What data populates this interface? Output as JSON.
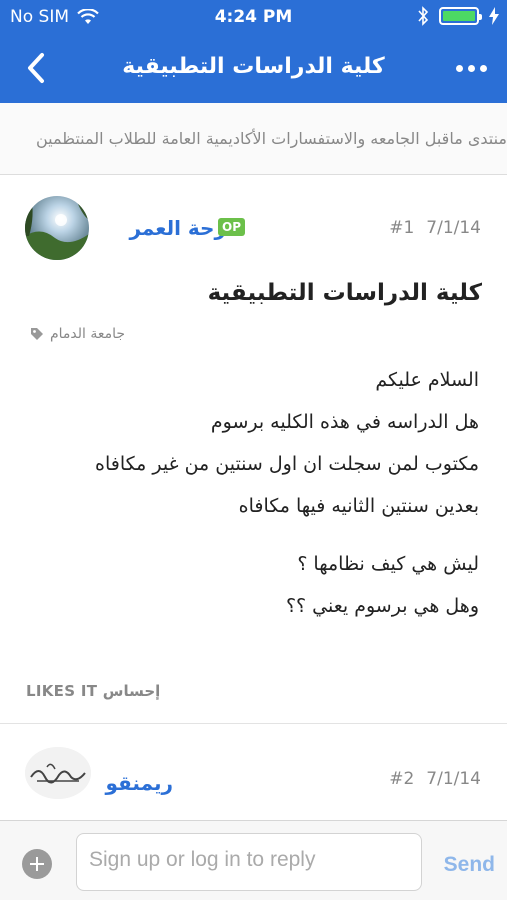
{
  "status_bar": {
    "carrier": "No SIM",
    "time": "4:24 PM",
    "battery_level": 1.0
  },
  "nav": {
    "title": "كلية الدراسات التطبيقية"
  },
  "breadcrumb": "منتدى ماقبل الجامعه والاستفسارات الأكاديمية العامة للطلاب المنتظمين",
  "posts": [
    {
      "author": "فرحة العمر",
      "op_badge": "OP",
      "number": "#1",
      "date": "7/1/14",
      "title": "كلية الدراسات التطبيقية",
      "category": "جامعة الدمام",
      "lines": [
        "السلام عليكم",
        "هل الدراسه في هذه الكليه برسوم",
        "مكتوب لمن سجلت ان اول سنتين من غير مكافاه",
        "بعدين سنتين الثانيه فيها مكافاه",
        "ليش هي كيف نظامها ؟",
        "وهل هي برسوم يعني ؟؟"
      ],
      "likes": "LIKES IT إحساس"
    },
    {
      "author": "ريمنقو",
      "number": "#2",
      "date": "7/1/14"
    }
  ],
  "reply": {
    "placeholder": "Sign up or log in to reply",
    "send_label": "Send"
  },
  "colors": {
    "header": "#2b6fd6",
    "link": "#2b6fd6",
    "op_badge": "#6cc04a",
    "battery": "#4cd964"
  }
}
